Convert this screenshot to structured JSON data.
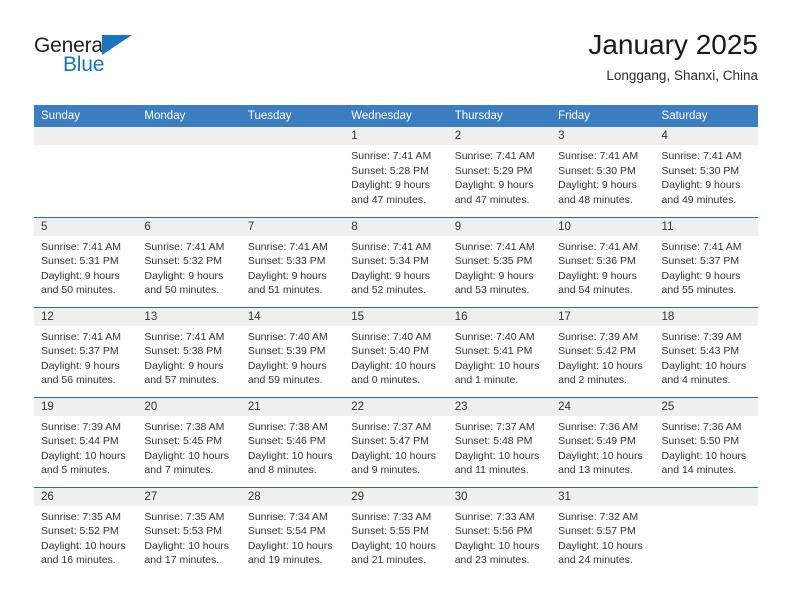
{
  "brand": {
    "name_part1": "General",
    "name_part2": "Blue",
    "accent_color": "#1b75bb",
    "logo_icon": "triangle-icon"
  },
  "header": {
    "title": "January 2025",
    "subtitle": "Longgang, Shanxi, China"
  },
  "calendar": {
    "header_color": "#3a7ebf",
    "weekdays": [
      "Sunday",
      "Monday",
      "Tuesday",
      "Wednesday",
      "Thursday",
      "Friday",
      "Saturday"
    ],
    "weeks": [
      [
        {
          "day": "",
          "lines": []
        },
        {
          "day": "",
          "lines": []
        },
        {
          "day": "",
          "lines": []
        },
        {
          "day": "1",
          "lines": [
            "Sunrise: 7:41 AM",
            "Sunset: 5:28 PM",
            "Daylight: 9 hours",
            "and 47 minutes."
          ]
        },
        {
          "day": "2",
          "lines": [
            "Sunrise: 7:41 AM",
            "Sunset: 5:29 PM",
            "Daylight: 9 hours",
            "and 47 minutes."
          ]
        },
        {
          "day": "3",
          "lines": [
            "Sunrise: 7:41 AM",
            "Sunset: 5:30 PM",
            "Daylight: 9 hours",
            "and 48 minutes."
          ]
        },
        {
          "day": "4",
          "lines": [
            "Sunrise: 7:41 AM",
            "Sunset: 5:30 PM",
            "Daylight: 9 hours",
            "and 49 minutes."
          ]
        }
      ],
      [
        {
          "day": "5",
          "lines": [
            "Sunrise: 7:41 AM",
            "Sunset: 5:31 PM",
            "Daylight: 9 hours",
            "and 50 minutes."
          ]
        },
        {
          "day": "6",
          "lines": [
            "Sunrise: 7:41 AM",
            "Sunset: 5:32 PM",
            "Daylight: 9 hours",
            "and 50 minutes."
          ]
        },
        {
          "day": "7",
          "lines": [
            "Sunrise: 7:41 AM",
            "Sunset: 5:33 PM",
            "Daylight: 9 hours",
            "and 51 minutes."
          ]
        },
        {
          "day": "8",
          "lines": [
            "Sunrise: 7:41 AM",
            "Sunset: 5:34 PM",
            "Daylight: 9 hours",
            "and 52 minutes."
          ]
        },
        {
          "day": "9",
          "lines": [
            "Sunrise: 7:41 AM",
            "Sunset: 5:35 PM",
            "Daylight: 9 hours",
            "and 53 minutes."
          ]
        },
        {
          "day": "10",
          "lines": [
            "Sunrise: 7:41 AM",
            "Sunset: 5:36 PM",
            "Daylight: 9 hours",
            "and 54 minutes."
          ]
        },
        {
          "day": "11",
          "lines": [
            "Sunrise: 7:41 AM",
            "Sunset: 5:37 PM",
            "Daylight: 9 hours",
            "and 55 minutes."
          ]
        }
      ],
      [
        {
          "day": "12",
          "lines": [
            "Sunrise: 7:41 AM",
            "Sunset: 5:37 PM",
            "Daylight: 9 hours",
            "and 56 minutes."
          ]
        },
        {
          "day": "13",
          "lines": [
            "Sunrise: 7:41 AM",
            "Sunset: 5:38 PM",
            "Daylight: 9 hours",
            "and 57 minutes."
          ]
        },
        {
          "day": "14",
          "lines": [
            "Sunrise: 7:40 AM",
            "Sunset: 5:39 PM",
            "Daylight: 9 hours",
            "and 59 minutes."
          ]
        },
        {
          "day": "15",
          "lines": [
            "Sunrise: 7:40 AM",
            "Sunset: 5:40 PM",
            "Daylight: 10 hours",
            "and 0 minutes."
          ]
        },
        {
          "day": "16",
          "lines": [
            "Sunrise: 7:40 AM",
            "Sunset: 5:41 PM",
            "Daylight: 10 hours",
            "and 1 minute."
          ]
        },
        {
          "day": "17",
          "lines": [
            "Sunrise: 7:39 AM",
            "Sunset: 5:42 PM",
            "Daylight: 10 hours",
            "and 2 minutes."
          ]
        },
        {
          "day": "18",
          "lines": [
            "Sunrise: 7:39 AM",
            "Sunset: 5:43 PM",
            "Daylight: 10 hours",
            "and 4 minutes."
          ]
        }
      ],
      [
        {
          "day": "19",
          "lines": [
            "Sunrise: 7:39 AM",
            "Sunset: 5:44 PM",
            "Daylight: 10 hours",
            "and 5 minutes."
          ]
        },
        {
          "day": "20",
          "lines": [
            "Sunrise: 7:38 AM",
            "Sunset: 5:45 PM",
            "Daylight: 10 hours",
            "and 7 minutes."
          ]
        },
        {
          "day": "21",
          "lines": [
            "Sunrise: 7:38 AM",
            "Sunset: 5:46 PM",
            "Daylight: 10 hours",
            "and 8 minutes."
          ]
        },
        {
          "day": "22",
          "lines": [
            "Sunrise: 7:37 AM",
            "Sunset: 5:47 PM",
            "Daylight: 10 hours",
            "and 9 minutes."
          ]
        },
        {
          "day": "23",
          "lines": [
            "Sunrise: 7:37 AM",
            "Sunset: 5:48 PM",
            "Daylight: 10 hours",
            "and 11 minutes."
          ]
        },
        {
          "day": "24",
          "lines": [
            "Sunrise: 7:36 AM",
            "Sunset: 5:49 PM",
            "Daylight: 10 hours",
            "and 13 minutes."
          ]
        },
        {
          "day": "25",
          "lines": [
            "Sunrise: 7:36 AM",
            "Sunset: 5:50 PM",
            "Daylight: 10 hours",
            "and 14 minutes."
          ]
        }
      ],
      [
        {
          "day": "26",
          "lines": [
            "Sunrise: 7:35 AM",
            "Sunset: 5:52 PM",
            "Daylight: 10 hours",
            "and 16 minutes."
          ]
        },
        {
          "day": "27",
          "lines": [
            "Sunrise: 7:35 AM",
            "Sunset: 5:53 PM",
            "Daylight: 10 hours",
            "and 17 minutes."
          ]
        },
        {
          "day": "28",
          "lines": [
            "Sunrise: 7:34 AM",
            "Sunset: 5:54 PM",
            "Daylight: 10 hours",
            "and 19 minutes."
          ]
        },
        {
          "day": "29",
          "lines": [
            "Sunrise: 7:33 AM",
            "Sunset: 5:55 PM",
            "Daylight: 10 hours",
            "and 21 minutes."
          ]
        },
        {
          "day": "30",
          "lines": [
            "Sunrise: 7:33 AM",
            "Sunset: 5:56 PM",
            "Daylight: 10 hours",
            "and 23 minutes."
          ]
        },
        {
          "day": "31",
          "lines": [
            "Sunrise: 7:32 AM",
            "Sunset: 5:57 PM",
            "Daylight: 10 hours",
            "and 24 minutes."
          ]
        },
        {
          "day": "",
          "lines": []
        }
      ]
    ]
  }
}
